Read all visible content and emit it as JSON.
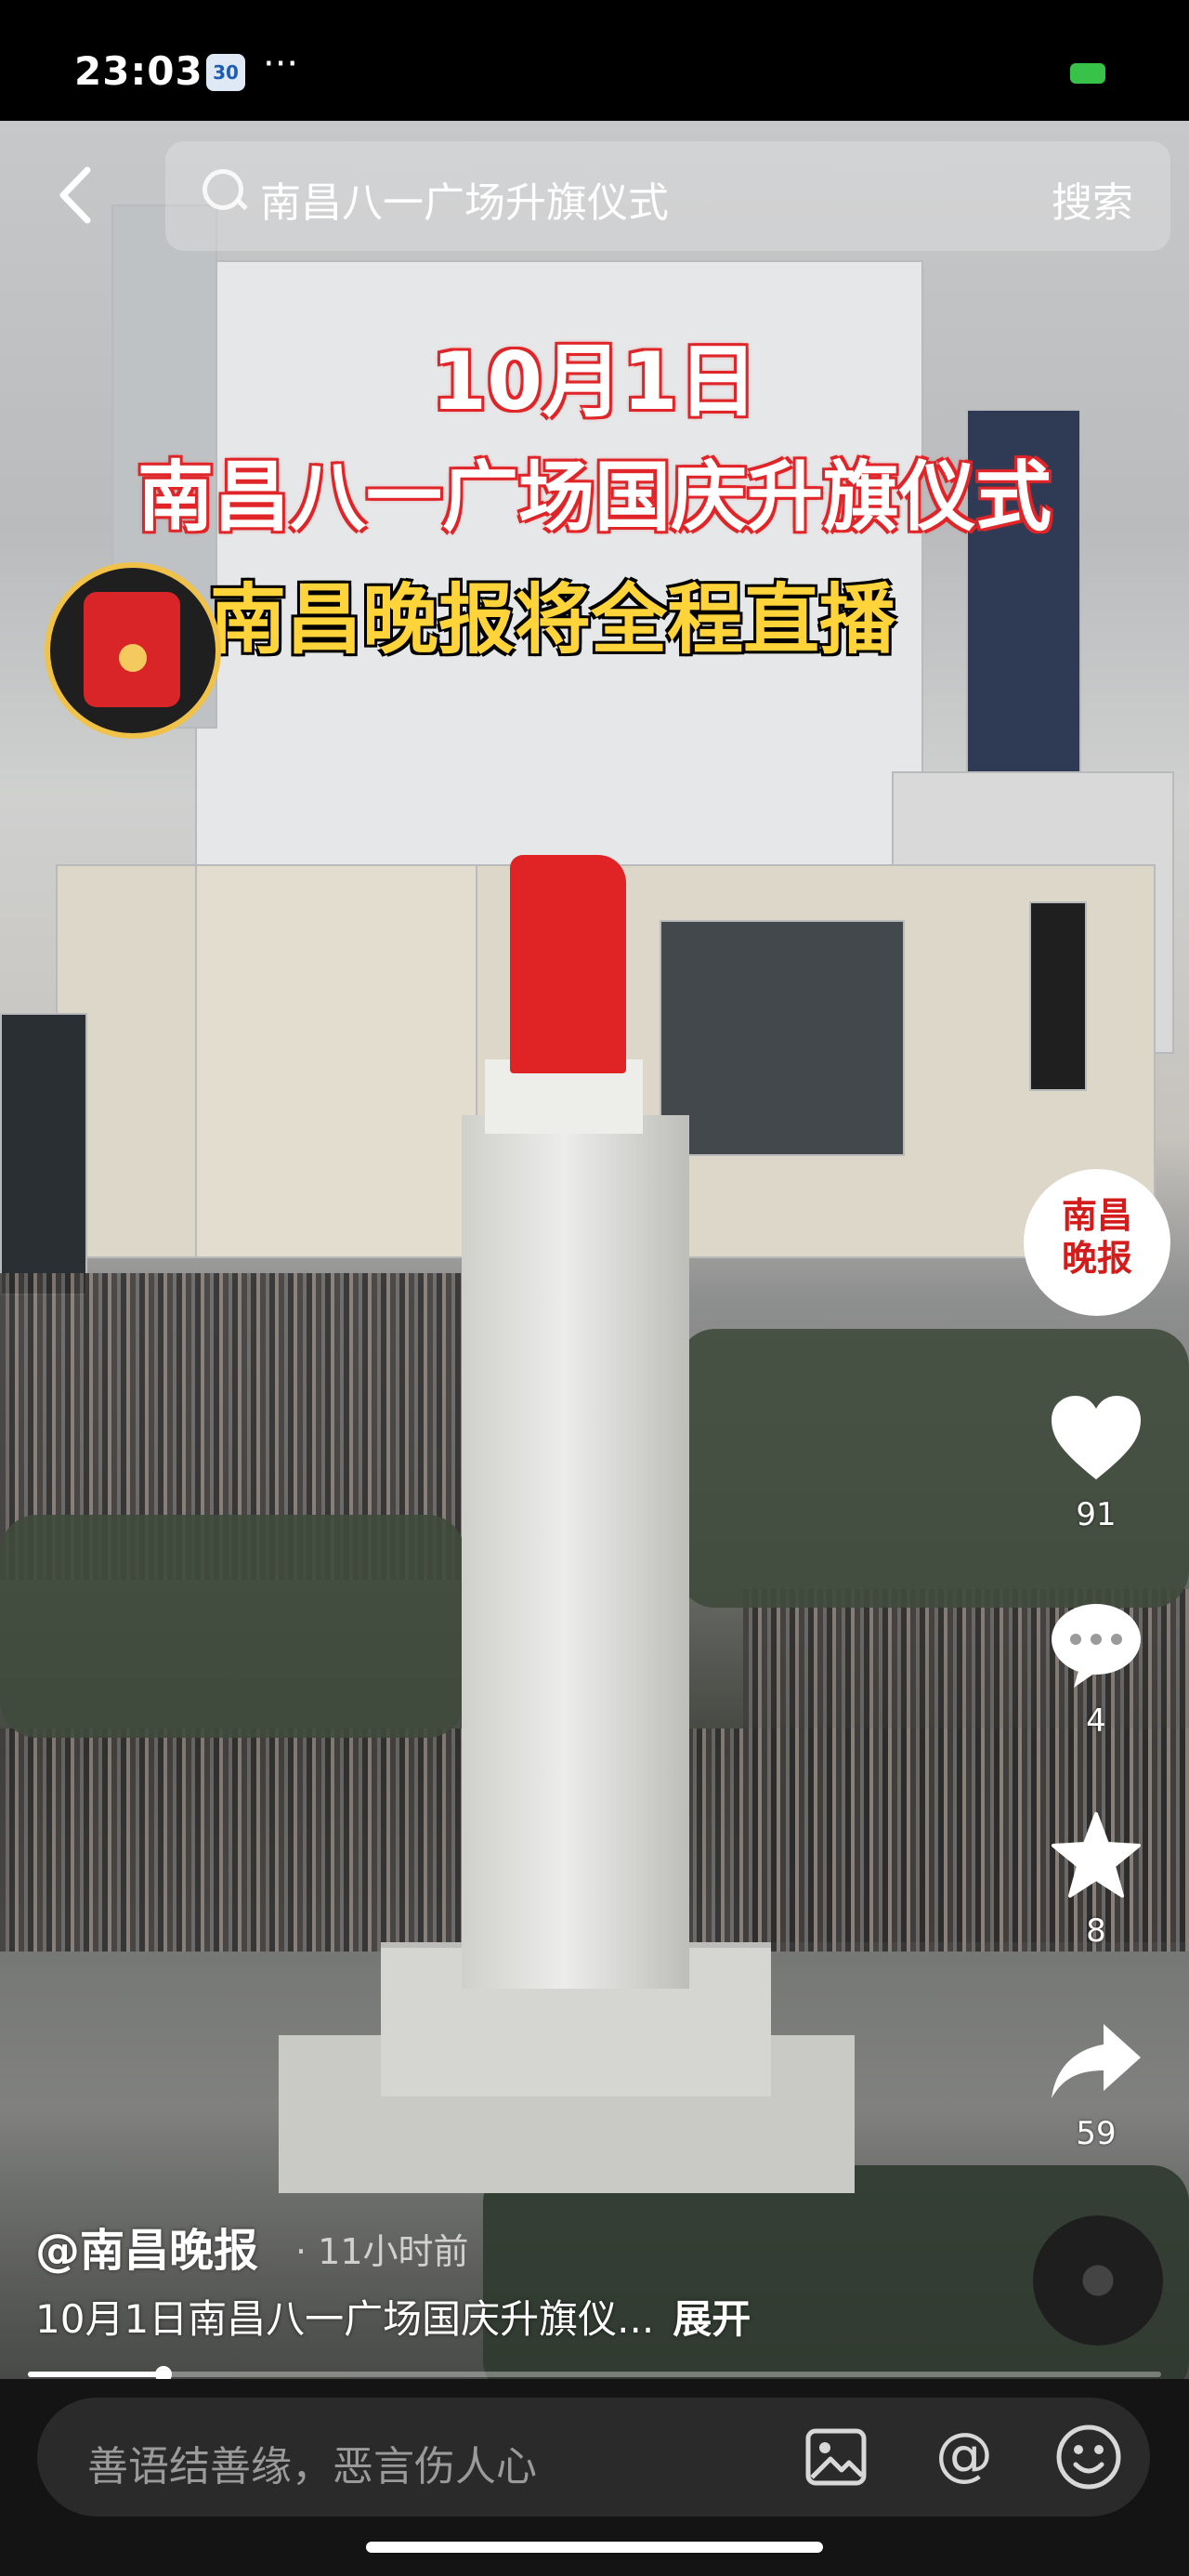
{
  "status_bar": {
    "time": "23:03",
    "calendar_badge": "30",
    "more": "···"
  },
  "search": {
    "back_label": "‹",
    "query": "南昌八一广场升旗仪式",
    "button": "搜索"
  },
  "video": {
    "title_line1": "10月1日",
    "title_line2": "南昌八一广场国庆升旗仪式",
    "title_line3": "南昌晚报将全程直播",
    "author": "@南昌晚报",
    "time_ago": "· 11小时前",
    "caption": "10月1日南昌八一广场国庆升旗仪...",
    "expand": "展开",
    "progress": 0.12
  },
  "logo_badge": {
    "line1": "南昌",
    "line2": "晚报"
  },
  "actions": {
    "likes": "91",
    "comments": "4",
    "favorites": "8",
    "shares": "59"
  },
  "comment_input": {
    "placeholder": "善语结善缘，恶言伤人心"
  },
  "icons": {
    "back": "chevron-left-icon",
    "search": "search-icon",
    "like": "heart-icon",
    "comment": "comment-icon",
    "favorite": "star-icon",
    "share": "share-icon",
    "image": "image-icon",
    "mention": "at-icon",
    "emoji": "emoji-icon"
  },
  "colors": {
    "accent_red": "#e0262a",
    "title_yellow": "#ffd33a",
    "bar_bg": "#141414"
  }
}
